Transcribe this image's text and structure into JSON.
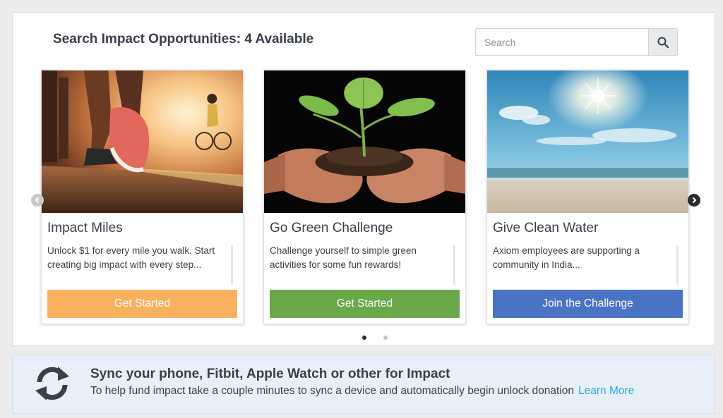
{
  "header": {
    "title": "Search Impact Opportunities: 4 Available"
  },
  "search": {
    "placeholder": "Search",
    "icon": "search-icon"
  },
  "cards": [
    {
      "title": "Impact Miles",
      "description": "Unlock $1 for every mile you walk. Start creating big impact with every step...",
      "button_label": "Get Started",
      "button_color": "#f9b15f",
      "image": "runner-sunset-image"
    },
    {
      "title": "Go Green Challenge",
      "description": "Challenge yourself to simple green activities for some fun rewards!",
      "button_label": "Get Started",
      "button_color": "#6aa84a",
      "image": "seedling-in-hands-image"
    },
    {
      "title": "Give Clean Water",
      "description": "Axiom employees are supporting a community in India...",
      "button_label": "Join the Challenge",
      "button_color": "#4a73c4",
      "image": "sunny-beach-image"
    }
  ],
  "carousel": {
    "prev_icon": "chevron-left-icon",
    "next_icon": "chevron-right-icon",
    "page_count": 2,
    "active_page": 1
  },
  "sync": {
    "icon": "sync-icon",
    "title": "Sync your phone, Fitbit, Apple Watch or other for Impact",
    "description": "To help fund impact take a couple minutes to sync a device and automatically begin unlock donation",
    "link_label": "Learn More",
    "link_color": "#2fa6d6"
  }
}
